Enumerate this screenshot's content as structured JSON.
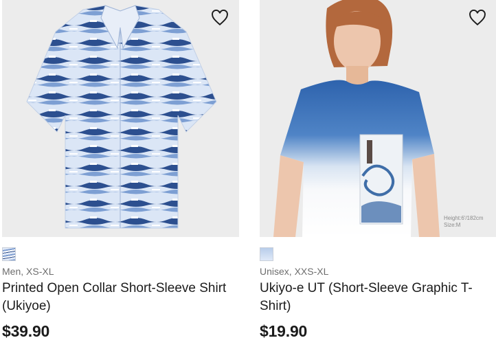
{
  "products": [
    {
      "image_alt": "Printed Open Collar Short-Sleeve Shirt (Ukiyoe)",
      "meta": "Men, XS-XL",
      "title": "Printed Open Collar Short-Sleeve Shirt (Ukiyoe)",
      "price": "$39.90",
      "favorite_icon": "heart-outline-icon"
    },
    {
      "image_alt": "Ukiyo-e UT (Short-Sleeve Graphic T-Shirt)",
      "meta": "Unisex, XXS-XL",
      "title": "Ukiyo-e UT (Short-Sleeve Graphic T-Shirt)",
      "price": "$19.90",
      "model_info_line1": "Height:6'/182cm",
      "model_info_line2": "Size:M",
      "favorite_icon": "heart-outline-icon"
    }
  ],
  "colors": {
    "background": "#ffffff",
    "image_background": "#ececec",
    "text": "#1b1b1b",
    "meta_text": "#6d6d6d"
  }
}
